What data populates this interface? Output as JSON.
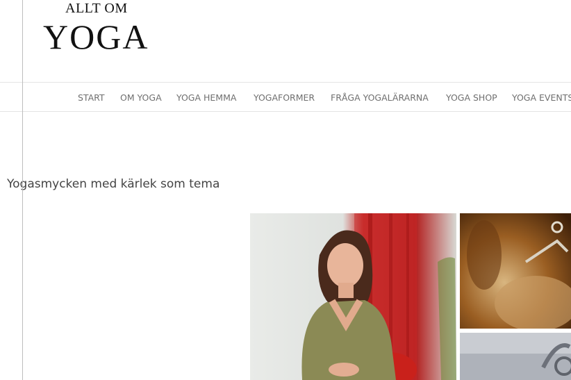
{
  "site": {
    "logo_small": "ALLT OM",
    "logo_big": "YOGA"
  },
  "nav": {
    "items": [
      {
        "label": "START"
      },
      {
        "label": "OM YOGA"
      },
      {
        "label": "YOGA HEMMA"
      },
      {
        "label": "YOGAFORMER"
      },
      {
        "label": "FRÅGA YOGALÄRARNA"
      },
      {
        "label": "YOGA SHOP"
      },
      {
        "label": "YOGA EVENTS"
      }
    ]
  },
  "post": {
    "title": "Yogasmycken med kärlek som tema"
  },
  "gallery": {
    "images": [
      {
        "name": "woman-portrait"
      },
      {
        "name": "jewelry-closeup-top"
      },
      {
        "name": "jewelry-closeup-bottom"
      }
    ]
  }
}
